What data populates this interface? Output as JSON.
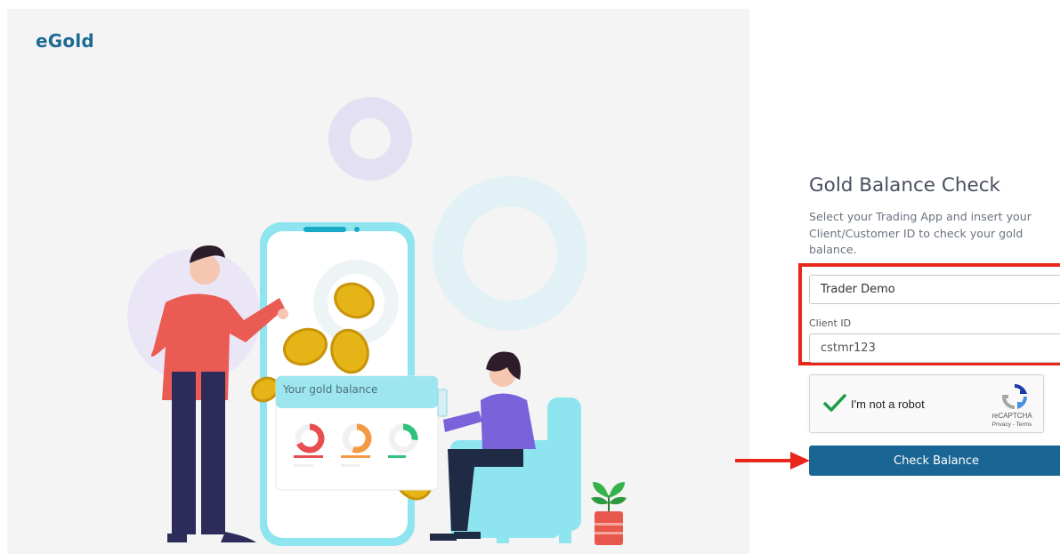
{
  "brand": {
    "logo_text": "eGold"
  },
  "illustration": {
    "card_title": "Your gold balance"
  },
  "form": {
    "title": "Gold Balance Check",
    "description": "Select your Trading App and insert your Client/Customer ID to check your gold balance.",
    "trading_app_selected": "Trader Demo",
    "client_id_label": "Client ID",
    "client_id_value": "cstmr123",
    "submit_label": "Check Balance"
  },
  "recaptcha": {
    "label": "I'm not a robot",
    "brand": "reCAPTCHA",
    "links": "Privacy - Terms",
    "checked": true
  },
  "annotations": {
    "highlight_color": "#e8261a",
    "arrow_color": "#e8261a"
  },
  "colors": {
    "brand_blue": "#1e6a93",
    "button_blue": "#196593",
    "panel_bg": "#f4f4f4"
  }
}
